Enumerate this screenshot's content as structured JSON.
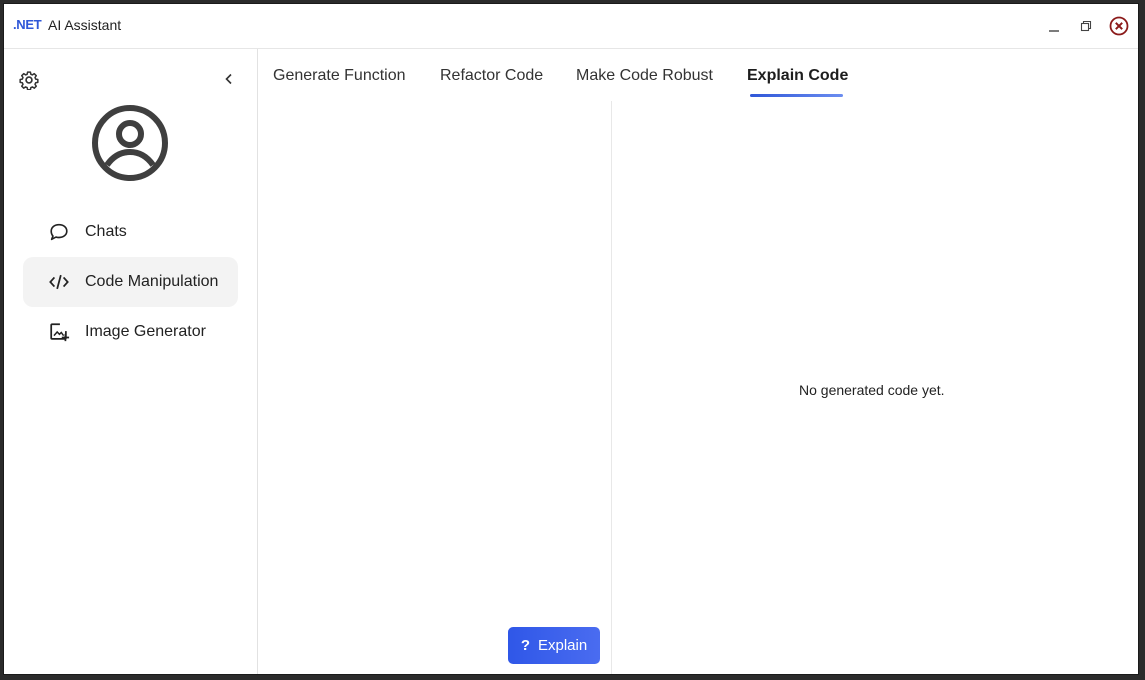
{
  "titlebar": {
    "logo": ".NET",
    "title": "AI Assistant",
    "icons": {
      "minimize": "minimize-icon",
      "restore": "restore-icon",
      "close": "close-icon"
    },
    "close_color": "#8b1a1a"
  },
  "sidebar": {
    "settings_icon": "gear-icon",
    "collapse_icon": "chevron-left-icon",
    "avatar_icon": "user-circle-icon",
    "items": [
      {
        "label": "Chats",
        "icon": "chat-bubble-icon",
        "active": false
      },
      {
        "label": "Code Manipulation",
        "icon": "code-icon",
        "active": true
      },
      {
        "label": "Image Generator",
        "icon": "image-add-icon",
        "active": false
      }
    ]
  },
  "main": {
    "tabs": [
      {
        "label": "Generate Function",
        "active": false
      },
      {
        "label": "Refactor Code",
        "active": false
      },
      {
        "label": "Make Code Robust",
        "active": false
      },
      {
        "label": "Explain Code",
        "active": true
      }
    ],
    "output_placeholder": "No generated code yet.",
    "explain_button": {
      "icon": "question-icon",
      "glyph": "?",
      "label": "Explain"
    },
    "accent": "#2f57d8"
  }
}
